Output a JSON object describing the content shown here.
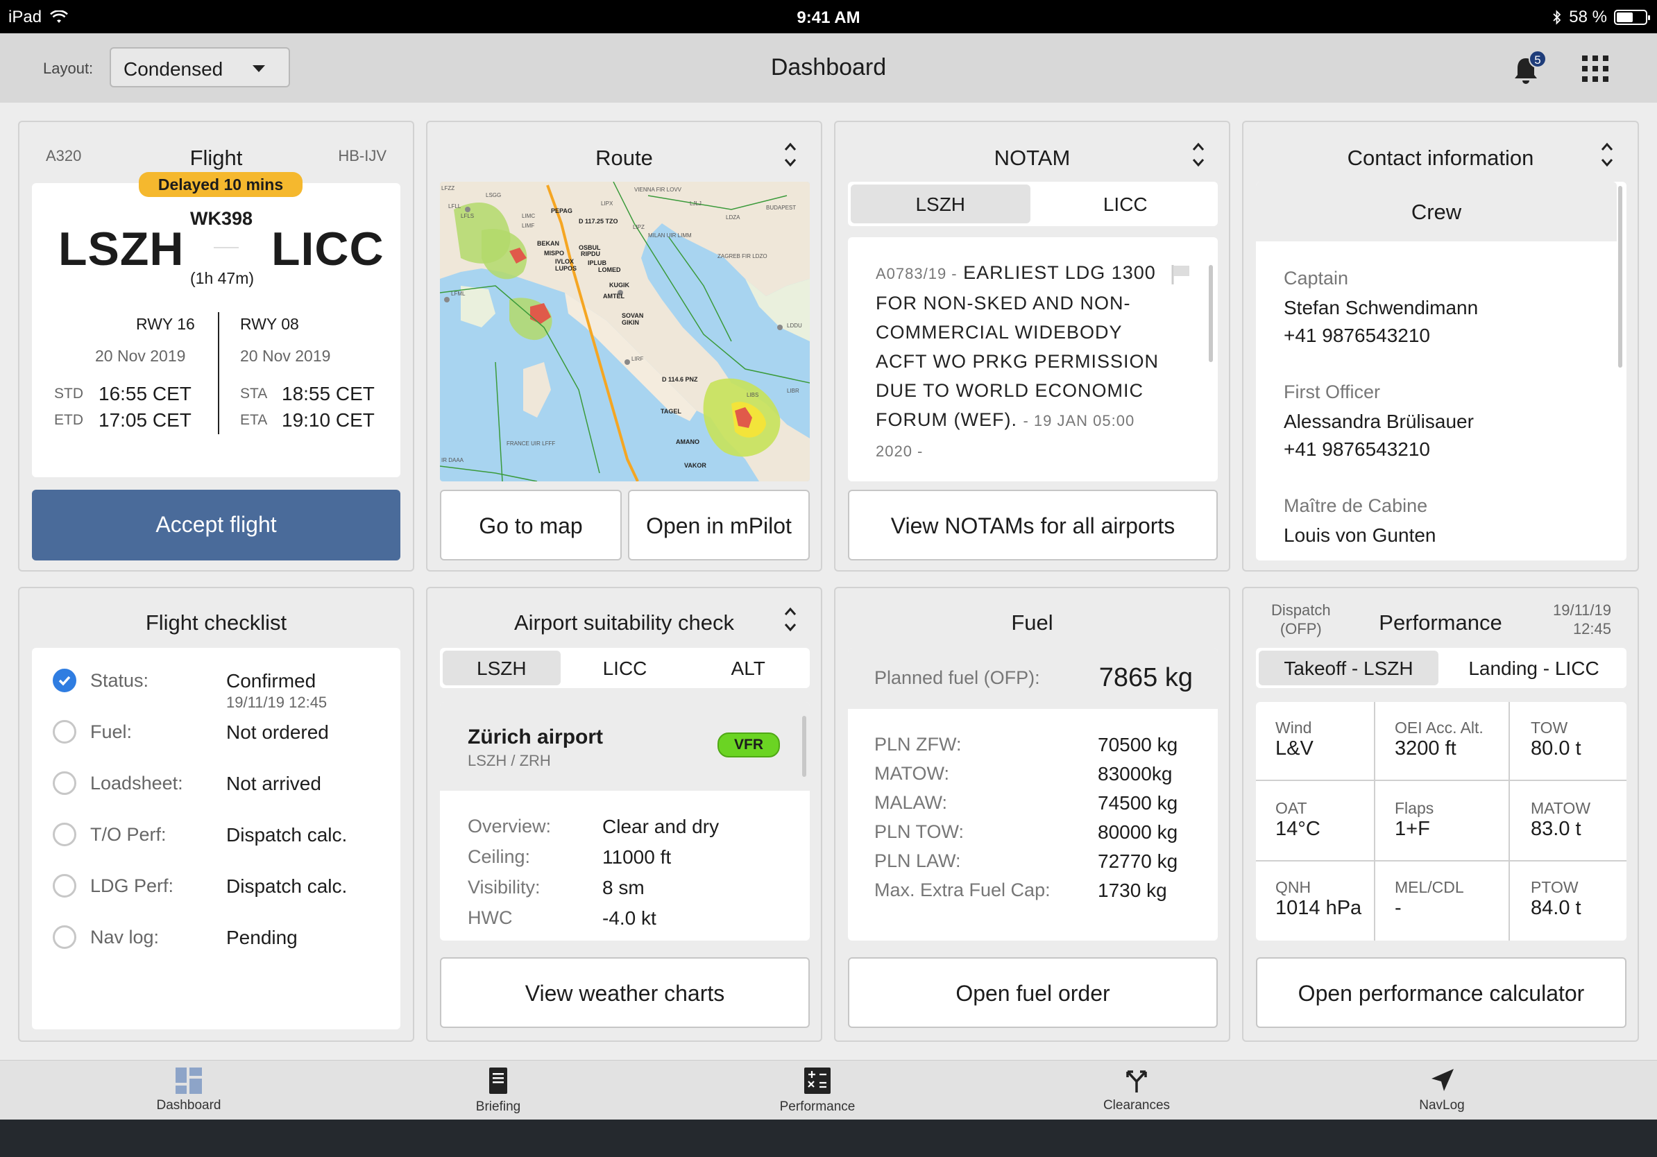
{
  "status_bar": {
    "device": "iPad",
    "time": "9:41 AM",
    "battery": "58 %",
    "battery_level": 0.58
  },
  "header": {
    "layout_label": "Layout:",
    "layout_value": "Condensed",
    "title": "Dashboard",
    "notification_count": "5"
  },
  "flight": {
    "title": "Flight",
    "aircraft_type": "A320",
    "registration": "HB-IJV",
    "delay_badge": "Delayed 10 mins",
    "origin": "LSZH",
    "destination": "LICC",
    "flight_number": "WK398",
    "duration": "(1h 47m)",
    "dep_runway": "RWY 16",
    "arr_runway": "RWY 08",
    "dep_date": "20 Nov 2019",
    "arr_date": "20 Nov 2019",
    "std_label": "STD",
    "std": "16:55 CET",
    "etd_label": "ETD",
    "etd": "17:05 CET",
    "sta_label": "STA",
    "sta": "18:55 CET",
    "eta_label": "ETA",
    "eta": "19:10 CET",
    "accept_button": "Accept flight",
    "accent": "#4a6b9a"
  },
  "route": {
    "title": "Route",
    "map_labels": [
      "PEPAG",
      "D 117.25 TZO",
      "BEKAN",
      "OSBUL",
      "MISPO",
      "RIPDU",
      "IVLOX",
      "IPLUB",
      "LUPOS",
      "LOMED",
      "KUGIK",
      "AMTEL",
      "SOVAN",
      "GIKIN",
      "D 114.6 PNZ",
      "TAGEL",
      "AMANO",
      "VAKOR",
      "LSGG",
      "LFLL",
      "LFLS",
      "LIMC",
      "LIMF",
      "LFML",
      "LIPZ",
      "LIPX",
      "LIRF",
      "LIBR",
      "LIBS",
      "LDZA",
      "LDDU",
      "LJLJ",
      "VIENNA FIR LOVV",
      "BUDAPEST",
      "MILAN UIR LIMM",
      "ZAGREB FIR LDZO",
      "FRANCE UIR LFFF",
      "IR DAAA",
      "LFZZ"
    ],
    "map_button": "Go to map",
    "mpilot_button": "Open in mPilot"
  },
  "notam": {
    "title": "NOTAM",
    "tabs": [
      "LSZH",
      "LICC"
    ],
    "active_tab": 0,
    "id": "A0783/19 -",
    "text": "EARLIEST LDG 1300 FOR NON-SKED AND NON-COMMERCIAL WIDEBODY ACFT WO PRKG PERMISSION DUE TO WORLD ECONOMIC FORUM (WEF).",
    "date": "- 19 JAN 05:00 2020 -",
    "button": "View NOTAMs for all airports"
  },
  "contact": {
    "title": "Contact information",
    "section": "Crew",
    "people": [
      {
        "role": "Captain",
        "name": "Stefan Schwendimann",
        "phone": "+41 9876543210"
      },
      {
        "role": "First Officer",
        "name": "Alessandra Brülisauer",
        "phone": "+41 9876543210"
      },
      {
        "role": "Maître de Cabine",
        "name": "Louis von Gunten"
      }
    ]
  },
  "checklist": {
    "title": "Flight checklist",
    "items": [
      {
        "label": "Status:",
        "value": "Confirmed",
        "sub": "19/11/19 12:45",
        "done": true
      },
      {
        "label": "Fuel:",
        "value": "Not ordered",
        "done": false
      },
      {
        "label": "Loadsheet:",
        "value": "Not arrived",
        "done": false
      },
      {
        "label": "T/O Perf:",
        "value": "Dispatch calc.",
        "done": false
      },
      {
        "label": "LDG Perf:",
        "value": "Dispatch calc.",
        "done": false
      },
      {
        "label": "Nav log:",
        "value": "Pending",
        "done": false
      }
    ]
  },
  "airport": {
    "title": "Airport suitability check",
    "tabs": [
      "LSZH",
      "LICC",
      "ALT"
    ],
    "active_tab": 0,
    "name": "Zürich airport",
    "codes": "LSZH / ZRH",
    "badge": "VFR",
    "rows": [
      {
        "label": "Overview:",
        "value": "Clear and dry"
      },
      {
        "label": "Ceiling:",
        "value": "11000 ft"
      },
      {
        "label": "Visibility:",
        "value": "8 sm"
      },
      {
        "label": "HWC",
        "value": "-4.0 kt"
      }
    ],
    "button": "View weather charts"
  },
  "fuel": {
    "title": "Fuel",
    "planned_label": "Planned fuel (OFP):",
    "planned_value": "7865 kg",
    "rows": [
      {
        "label": "PLN ZFW:",
        "value": "70500 kg"
      },
      {
        "label": "MATOW:",
        "value": "83000kg"
      },
      {
        "label": "MALAW:",
        "value": "74500 kg"
      },
      {
        "label": "PLN TOW:",
        "value": "80000 kg"
      },
      {
        "label": "PLN LAW:",
        "value": "72770 kg"
      },
      {
        "label": "Max. Extra Fuel Cap:",
        "value": "1730 kg"
      }
    ],
    "button": "Open fuel order"
  },
  "performance": {
    "title": "Performance",
    "source_line1": "Dispatch",
    "source_line2": "(OFP)",
    "date": "19/11/19",
    "time": "12:45",
    "tabs": [
      "Takeoff - LSZH",
      "Landing - LICC"
    ],
    "active_tab": 0,
    "cells": [
      {
        "label": "Wind",
        "value": "L&V"
      },
      {
        "label": "OEI Acc. Alt.",
        "value": "3200 ft"
      },
      {
        "label": "TOW",
        "value": "80.0 t"
      },
      {
        "label": "OAT",
        "value": "14°C"
      },
      {
        "label": "Flaps",
        "value": "1+F"
      },
      {
        "label": "MATOW",
        "value": "83.0 t"
      },
      {
        "label": "QNH",
        "value": "1014 hPa"
      },
      {
        "label": "MEL/CDL",
        "value": "-"
      },
      {
        "label": "PTOW",
        "value": "84.0 t"
      }
    ],
    "button": "Open performance calculator"
  },
  "tabbar": {
    "items": [
      {
        "label": "Dashboard",
        "icon": "dashboard-icon",
        "active": true
      },
      {
        "label": "Briefing",
        "icon": "document-icon",
        "active": false
      },
      {
        "label": "Performance",
        "icon": "calculator-icon",
        "active": false
      },
      {
        "label": "Clearances",
        "icon": "fork-arrow-icon",
        "active": false
      },
      {
        "label": "NavLog",
        "icon": "navigation-arrow-icon",
        "active": false
      }
    ]
  }
}
